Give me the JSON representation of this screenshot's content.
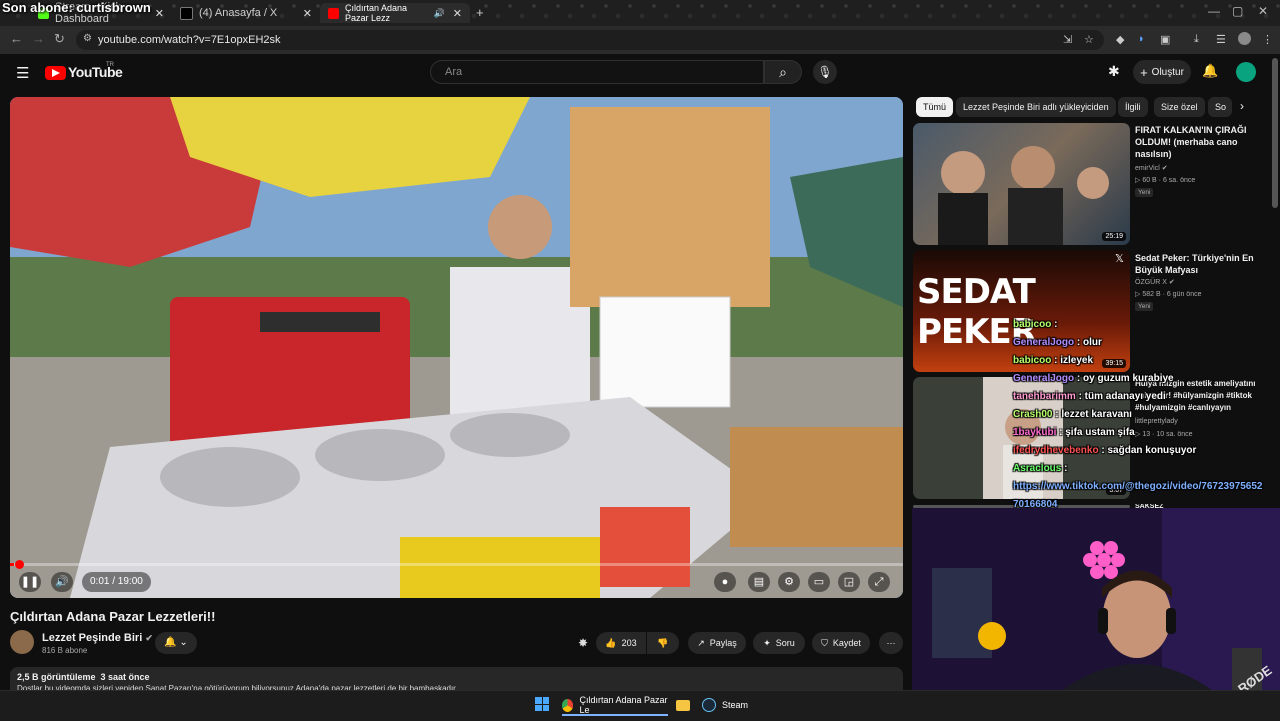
{
  "browser": {
    "overlay_text": "Son abone: curtisbrown",
    "tabs": [
      {
        "label": "Stream - Kick Dashboard",
        "active": false
      },
      {
        "label": "(4) Anasayfa / X",
        "active": false
      },
      {
        "label": "Çıldırtan Adana Pazar Lezz",
        "active": true
      }
    ],
    "url": "youtube.com/watch?v=7E1opxEH2sk"
  },
  "youtube": {
    "logo": "YouTube",
    "logo_region": "TR",
    "search_placeholder": "Ara",
    "create_label": "Oluştur"
  },
  "video": {
    "time": "0:01 / 19:00",
    "progress_fraction": 0.0009,
    "title": "Çıldırtan Adana Pazar Lezzetleri!!",
    "channel": "Lezzet Peşinde Biri",
    "subscribers": "816 B abone",
    "likes": "203",
    "share_label": "Paylaş",
    "ask_label": "Soru",
    "save_label": "Kaydet",
    "views": "2,5 B görüntüleme",
    "posted": "3 saat önce",
    "description": "Dostlar bu videomda sizleri yeniden Sanat Pazarı'na götürüyorum biliyorsunuz Adana'da pazar lezzetleri de bir bambaşkadır"
  },
  "chips": [
    "Tümü",
    "Lezzet Peşinde Biri adlı yükleyiciden",
    "İlgili",
    "Size özel",
    "So"
  ],
  "recommendations": [
    {
      "title": "FIRAT KALKAN'IN ÇIRAĞI OLDUM! (merhaba cano nasılsın)",
      "channel": "emirVicl",
      "meta": "60 B · 6 sa. önce",
      "badge": "Yeni",
      "duration": "25:19"
    },
    {
      "title": "Sedat Peker: Türkiye'nin En Büyük Mafyası",
      "channel": "ÖZGÜR X",
      "meta": "582 B · 6 gün önce",
      "badge": "Yeni",
      "duration": "39:15",
      "thumb_text": "SEDAT PEKER"
    },
    {
      "title": "Hülya mizgin estetik ameliyatını anlatıyor! #hülyamizgin #tiktok #hulyamizgin #canlıyayın",
      "channel": "littleprettylady",
      "meta": "13 · 10 sa. önce",
      "duration": "3:07"
    },
    {
      "title": "SAKSEZ",
      "channel": "",
      "meta": "",
      "duration": ""
    }
  ],
  "chat": [
    {
      "user": "babicoo",
      "msg": ":",
      "color": "#b6ff6b"
    },
    {
      "user": "GeneralJogo",
      "msg": ": olur",
      "color": "#b28cff"
    },
    {
      "user": "babicoo",
      "msg": ": izleyek",
      "color": "#b6ff6b"
    },
    {
      "user": "GeneralJogo",
      "msg": ": oy guzum kurabiye",
      "color": "#b28cff"
    },
    {
      "user": "tanehbarimm",
      "msg": ": tüm adanayı yedi",
      "color": "#ff9bd1"
    },
    {
      "user": "Crash00",
      "msg": ": lezzet karavanı",
      "color": "#b6ff6b"
    },
    {
      "user": "1baykubi",
      "msg": ": şifa ustam şifa",
      "color": "#ff6bd1"
    },
    {
      "user": "ifedrydhevebenko",
      "msg": ": sağdan konuşuyor",
      "color": "#ff5252"
    },
    {
      "user": "Asraclous",
      "msg": ":",
      "color": "#6bff6b"
    },
    {
      "user": "https://www.tiktok.com/@thegozi/video/76723975652",
      "msg": "",
      "color": "#7fb0ff"
    },
    {
      "user": "70166804",
      "msg": "",
      "color": "#7fb0ff"
    }
  ],
  "taskbar": {
    "chrome_label": "Çıldırtan Adana Pazar Le",
    "steam_label": "Steam"
  },
  "colors": {
    "accent": "#ff0000",
    "bg": "#0f0f0f"
  }
}
